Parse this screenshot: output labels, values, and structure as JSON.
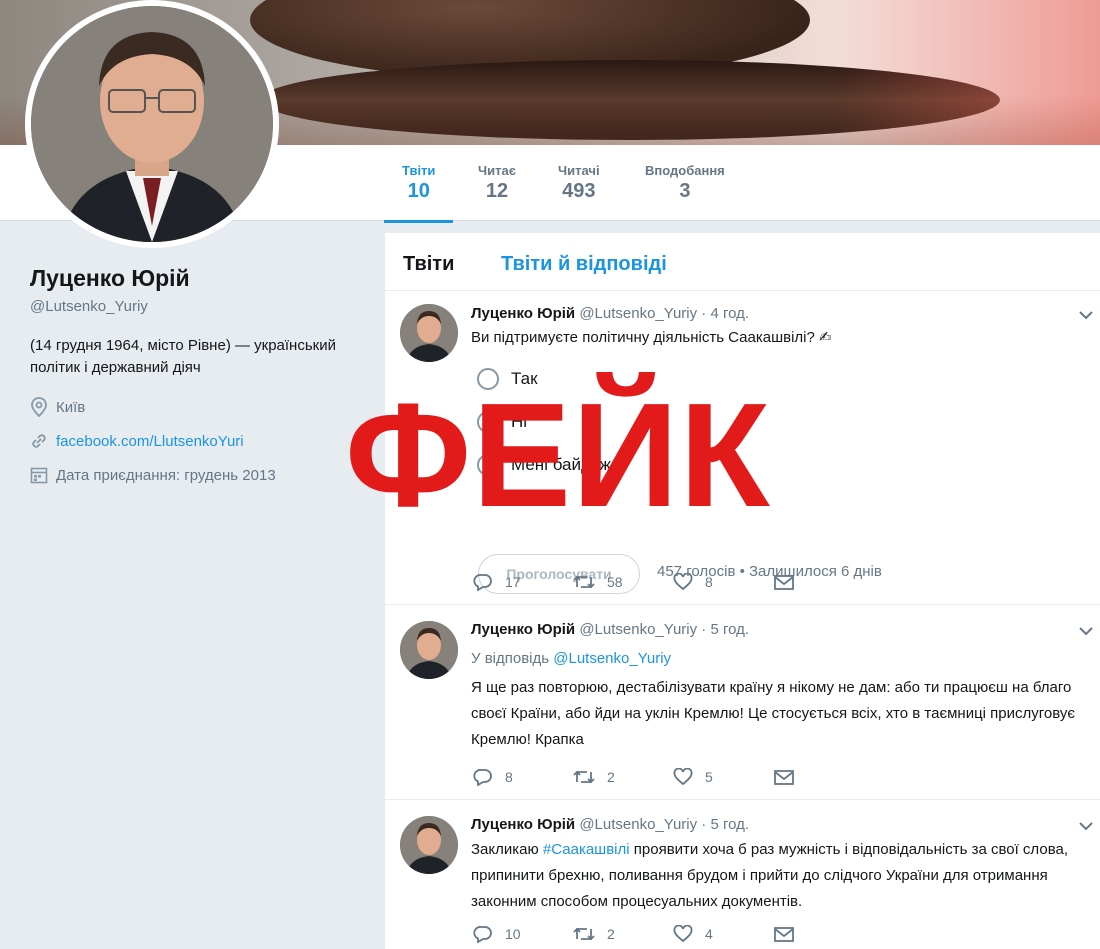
{
  "stats": [
    {
      "label": "Твіти",
      "value": "10"
    },
    {
      "label": "Читає",
      "value": "12"
    },
    {
      "label": "Читачі",
      "value": "493"
    },
    {
      "label": "Вподобання",
      "value": "3"
    }
  ],
  "profile": {
    "name": "Луценко Юрій",
    "handle": "@Lutsenko_Yuriy",
    "bio": "(14 грудня 1964, місто Рівне) — український політик і державний діяч",
    "location": "Київ",
    "website": "facebook.com/LlutsenkoYuri",
    "joined": "Дата приєднання: грудень 2013"
  },
  "tabs": {
    "tweets": "Твіти",
    "replies": "Твіти й відповіді"
  },
  "tweets": [
    {
      "name": "Луценко Юрій",
      "meta": "@Lutsenko_Yuriy · 4 год.",
      "text": "Ви підтримуєте політичну діяльність Саакашвілі? ✍",
      "poll": {
        "options": [
          "Так",
          "Ні",
          "Мені байдуже"
        ],
        "vote_label": "Проголосувати",
        "meta": "457 голосів • Залишилося 6 днів"
      },
      "replies": "17",
      "retweets": "58",
      "likes": "8"
    },
    {
      "name": "Луценко Юрій",
      "meta": "@Lutsenko_Yuriy · 5 год.",
      "reply_prefix": "У відповідь",
      "reply_to": "@Lutsenko_Yuriy",
      "text": "Я ще раз повторюю, дестабілізувати країну я нікому не дам: або ти працюєш на благо своєї Країни, або йди на уклін Кремлю! Це стосується всіх, хто в таємниці прислуговує Кремлю! Крапка",
      "replies": "8",
      "retweets": "2",
      "likes": "5"
    },
    {
      "name": "Луценко Юрій",
      "meta": "@Lutsenko_Yuriy · 5 год.",
      "text_pre": "Закликаю",
      "hashtag": "#Саакашвілі",
      "text_post": "проявити хоча б раз мужність і відповідальність за свої слова, припинити брехню, поливання брудом і прийти до слідчого України для отримання законним способом процесуальних документів.",
      "replies": "10",
      "retweets": "2",
      "likes": "4"
    }
  ],
  "stamp": "ФЕЙК",
  "colors": {
    "accent": "#1b95e0",
    "stamp": "#e21a1a",
    "muted": "#657786"
  }
}
